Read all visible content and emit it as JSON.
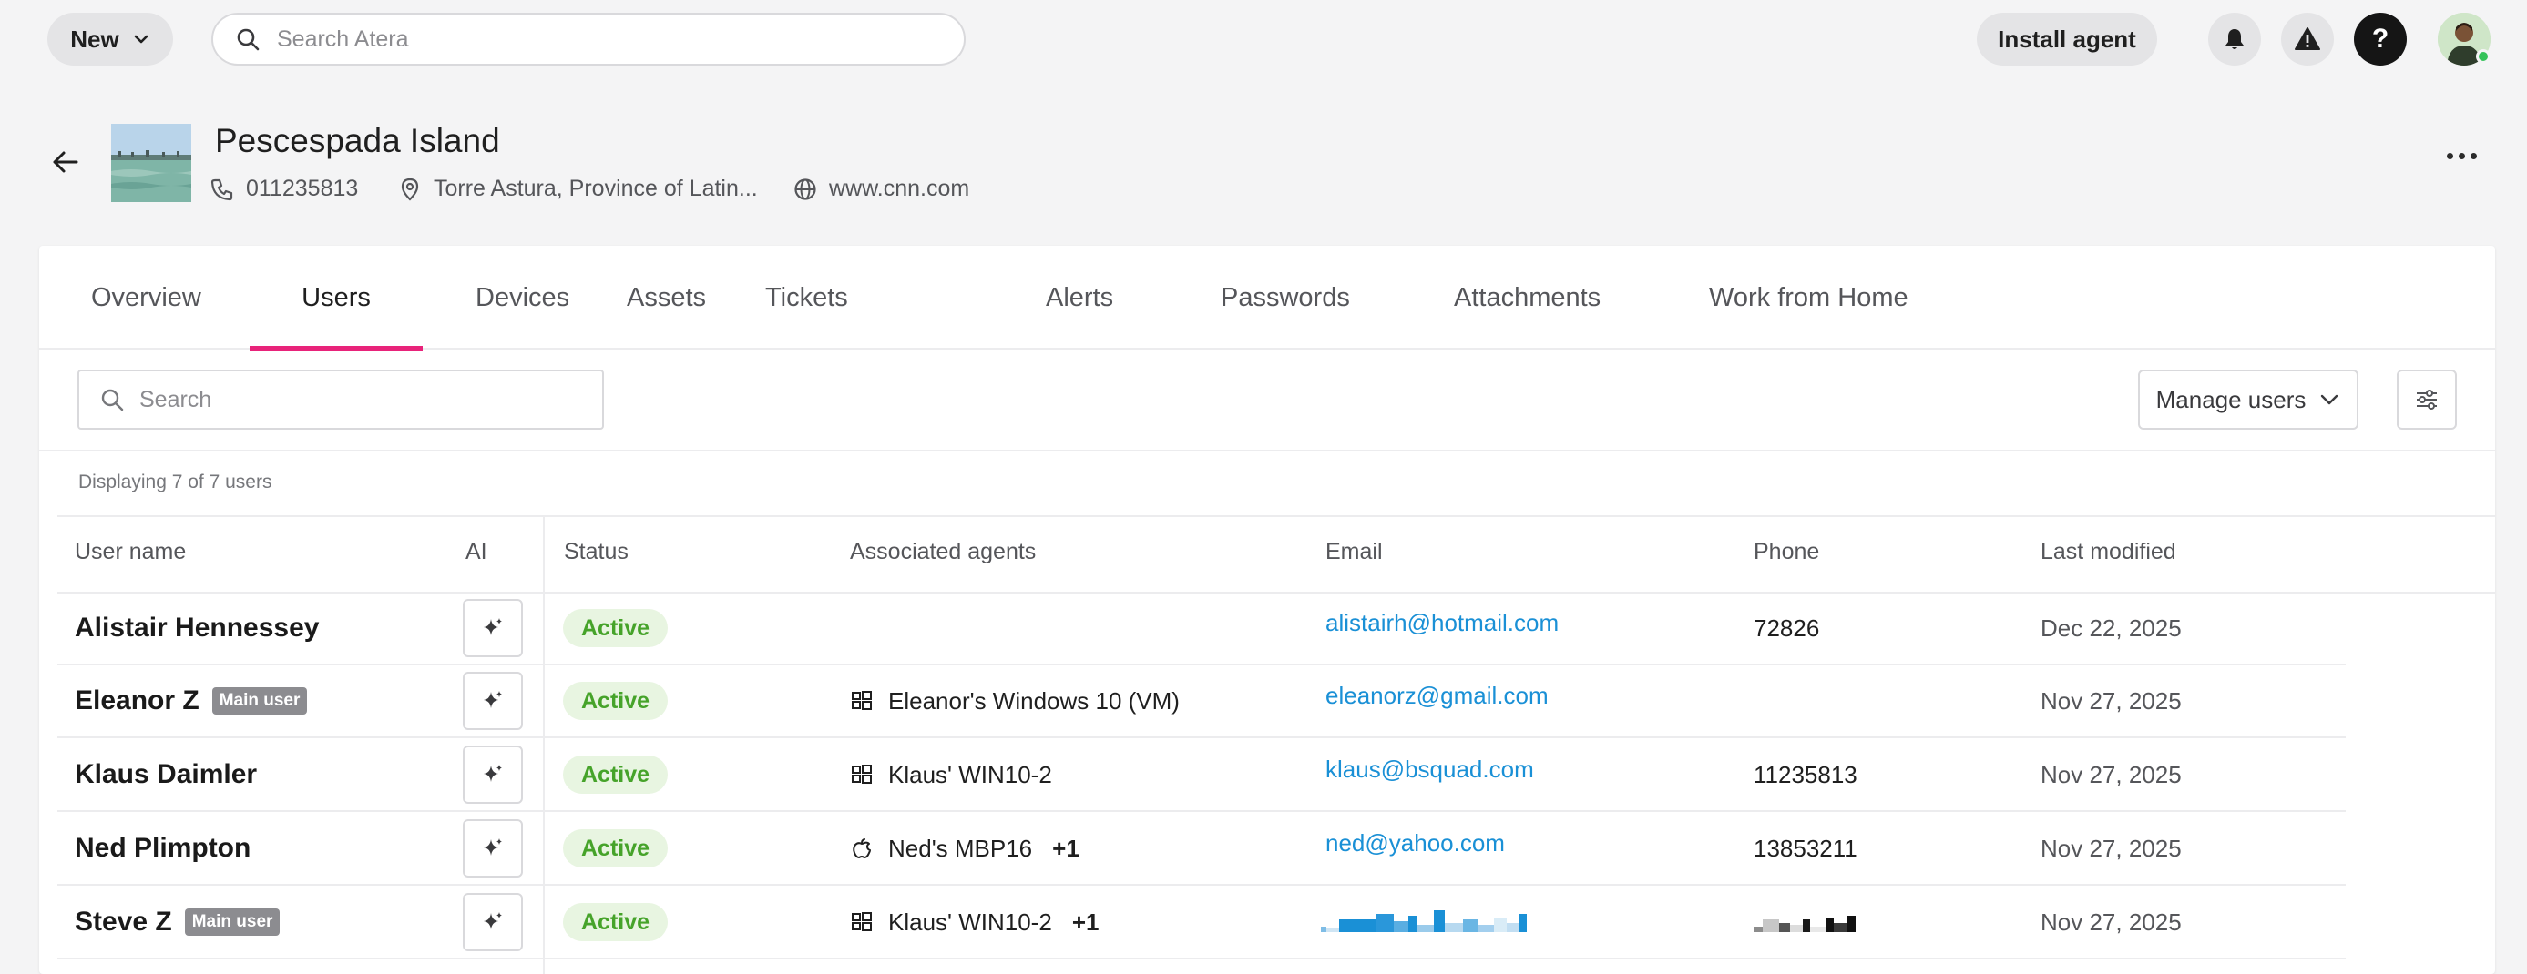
{
  "topbar": {
    "new_label": "New",
    "search_placeholder": "Search Atera",
    "install_label": "Install agent",
    "help_glyph": "?"
  },
  "customer": {
    "name": "Pescespada Island",
    "phone": "011235813",
    "location": "Torre Astura, Province of Latin...",
    "website": "www.cnn.com"
  },
  "tabs": [
    {
      "label": "Overview",
      "active": false
    },
    {
      "label": "Users",
      "active": true
    },
    {
      "label": "Devices",
      "active": false
    },
    {
      "label": "Assets",
      "active": false
    },
    {
      "label": "Tickets",
      "active": false
    },
    {
      "label": "Alerts",
      "active": false
    },
    {
      "label": "Passwords",
      "active": false
    },
    {
      "label": "Attachments",
      "active": false
    },
    {
      "label": "Work from Home",
      "active": false
    }
  ],
  "users_panel": {
    "search_placeholder": "Search",
    "manage_label": "Manage users",
    "display_count": "Displaying 7 of 7 users"
  },
  "table": {
    "headers": {
      "user_name": "User name",
      "ai": "AI",
      "status": "Status",
      "agents": "Associated agents",
      "email": "Email",
      "phone": "Phone",
      "modified": "Last modified"
    },
    "rows": [
      {
        "name": "Alistair Hennessey",
        "badge": "",
        "status": "Active",
        "agent": "",
        "agent_os": "",
        "agent_extra": "",
        "email": "alistairh@hotmail.com",
        "phone": "72826",
        "modified": "Dec 22, 2025"
      },
      {
        "name": "Eleanor Z",
        "badge": "Main user",
        "status": "Active",
        "agent": "Eleanor's Windows 10 (VM)",
        "agent_os": "windows-icon",
        "agent_extra": "",
        "email": "eleanorz@gmail.com",
        "phone": "",
        "modified": "Nov 27, 2025"
      },
      {
        "name": "Klaus Daimler",
        "badge": "",
        "status": "Active",
        "agent": "Klaus' WIN10-2",
        "agent_os": "windows-icon",
        "agent_extra": "",
        "email": "klaus@bsquad.com",
        "phone": "11235813",
        "modified": "Nov 27, 2025"
      },
      {
        "name": "Ned Plimpton",
        "badge": "",
        "status": "Active",
        "agent": "Ned's MBP16",
        "agent_os": "apple-icon",
        "agent_extra": "+1",
        "email": "ned@yahoo.com",
        "phone": "13853211",
        "modified": "Nov 27, 2025"
      },
      {
        "name": "Steve Z",
        "badge": "Main user",
        "status": "Active",
        "agent": "Klaus' WIN10-2",
        "agent_os": "windows-icon",
        "agent_extra": "+1",
        "email": "",
        "phone": "",
        "modified": "Nov 27, 2025"
      }
    ]
  },
  "colors": {
    "accent": "#e8237a",
    "link": "#1a90d6",
    "status_active_bg": "#e8f5e1",
    "status_active_text": "#46a32a"
  }
}
